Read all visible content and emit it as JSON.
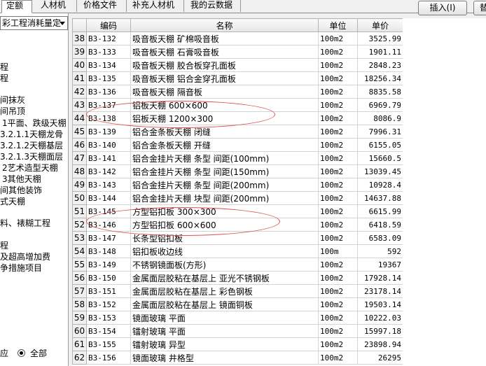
{
  "tabs": [
    {
      "label": "定额",
      "active": true
    },
    {
      "label": "人材机",
      "active": false
    },
    {
      "label": "价格文件",
      "active": false
    },
    {
      "label": "补充人材机",
      "active": false
    },
    {
      "label": "我的云数据",
      "active": false
    }
  ],
  "toolbar": {
    "insert_label": "插入(I)",
    "replace_label": "替"
  },
  "left": {
    "dropdown_value": "彩工程消耗量定",
    "tree": [
      "程",
      "程",
      "",
      "间抹灰",
      "间吊顶",
      "1平面、跌级天棚",
      "3.2.1.1天棚龙骨",
      "3.2.1.2天棚基层",
      "3.2.1.3天棚面层",
      "2艺术造型天棚",
      "3其他天棚",
      "间其他装饰",
      "式天棚",
      "",
      "料、裱糊工程",
      "",
      "程",
      "及超高增加费",
      "争措施项目"
    ],
    "radio_left_label": "应",
    "radio_all_label": "全部"
  },
  "table": {
    "headers": [
      "",
      "编码",
      "名称",
      "单位",
      "单价"
    ],
    "rows": [
      [
        "38",
        "B3-132",
        "吸音板天棚 矿棉吸音板",
        "100m2",
        "3525.99"
      ],
      [
        "39",
        "B3-133",
        "吸音板天棚 石膏吸音板",
        "100m2",
        "1901.11"
      ],
      [
        "40",
        "B3-134",
        "吸音板天棚 胶合板穿孔面板",
        "100m2",
        "2848.23"
      ],
      [
        "41",
        "B3-135",
        "吸音板天棚 铝合金穿孔面板",
        "100m2",
        "18256.34"
      ],
      [
        "42",
        "B3-136",
        "吸音板天棚 隔音板",
        "100m2",
        "8835.58"
      ],
      [
        "43",
        "B3-137",
        "铝板天棚 600×600",
        "100m2",
        "6969.79"
      ],
      [
        "44",
        "B3-138",
        "铝板天棚 1200×300",
        "100m2",
        "8086.9"
      ],
      [
        "45",
        "B3-139",
        "铝合金条板天棚 闭缝",
        "100m2",
        "7996.31"
      ],
      [
        "46",
        "B3-140",
        "铝合金条板天棚 开缝",
        "100m2",
        "6155.05"
      ],
      [
        "47",
        "B3-141",
        "铝合金挂片天棚 条型 间距(100mm)",
        "100m2",
        "15660.5"
      ],
      [
        "48",
        "B3-142",
        "铝合金挂片天棚 条型 间距(150mm)",
        "100m2",
        "13039.45"
      ],
      [
        "49",
        "B3-143",
        "铝合金挂片天棚 条型 间距(200mm)",
        "100m2",
        "10928.4"
      ],
      [
        "50",
        "B3-144",
        "铝合金挂片天棚 块型 间距(200mm)",
        "100m2",
        "14637.88"
      ],
      [
        "51",
        "B3-145",
        "方型铝扣板 300×300",
        "100m2",
        "6615.99"
      ],
      [
        "52",
        "B3-146",
        "方型铝扣板 600×600",
        "100m2",
        "6418.59"
      ],
      [
        "53",
        "B3-147",
        "长条型铝扣板",
        "100m2",
        "6583.09"
      ],
      [
        "54",
        "B3-148",
        "铝扣板收边线",
        "100m",
        "592"
      ],
      [
        "55",
        "B3-149",
        "不锈钢镜面板(方形)",
        "100m2",
        "19367"
      ],
      [
        "56",
        "B3-150",
        "金属面层胶粘在基层上 亚光不锈钢板",
        "100m2",
        "17928.14"
      ],
      [
        "57",
        "B3-151",
        "金属面层胶粘在基层上 彩色钢板",
        "100m2",
        "23178.14"
      ],
      [
        "58",
        "B3-152",
        "金属面层胶粘在基层上 镜面铜板",
        "100m2",
        "19503.14"
      ],
      [
        "59",
        "B3-153",
        "镜面玻璃 平面",
        "100m2",
        "10222.03"
      ],
      [
        "60",
        "B3-154",
        "镭射玻璃 平面",
        "100m2",
        "15997.18"
      ],
      [
        "61",
        "B3-155",
        "镭射玻璃 异型",
        "100m2",
        "23898.94"
      ],
      [
        "62",
        "B3-156",
        "镜面玻璃 井格型",
        "100m2",
        "26295"
      ]
    ]
  }
}
